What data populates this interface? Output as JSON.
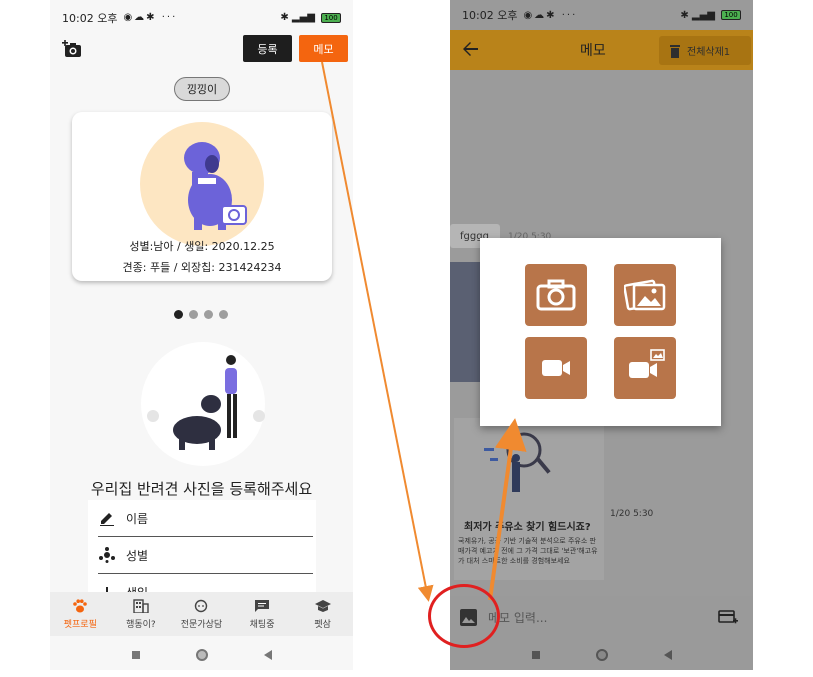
{
  "left_screen": {
    "status": {
      "time": "10:02 오후",
      "battery": "100"
    },
    "header": {
      "register_label": "등록",
      "memo_label": "메모"
    },
    "pet_name": "낑낑이",
    "profile": {
      "line1": "성별:남아 / 생일: 2020.12.25",
      "line2": "견종: 푸들 / 외장칩: 231424234"
    },
    "register_prompt": "우리집 반려견 사진을 등록해주세요",
    "form": {
      "name_label": "이름",
      "gender_label": "성별",
      "birth_label": "생일"
    },
    "nav": [
      {
        "label": "펫프로필"
      },
      {
        "label": "행동이?"
      },
      {
        "label": "전문가상담"
      },
      {
        "label": "채팅중"
      },
      {
        "label": "펫삼"
      }
    ],
    "accent_color": "#f4650f"
  },
  "right_screen": {
    "status": {
      "time": "10:02 오후",
      "battery": "100"
    },
    "appbar": {
      "title": "메모",
      "delete_all_label": "전체삭제1"
    },
    "memo_chip": "fgggg",
    "memo_date_top": "1/20 5:30",
    "ad": {
      "title": "최저가 주유소 찾기 힘드시죠?",
      "body": "국제유가, 공공 기반 기술적 분석으로 주유소 판매가격 예고가 전에 그 가격 그대로 '보관'해고유가 대처 스마트한 소비를 경험해보세요"
    },
    "memo_date_bottom": "1/20 5:30",
    "input": {
      "placeholder": "메모 입력..."
    },
    "picker_tiles": [
      "camera-icon",
      "gallery-icon",
      "video-icon",
      "video-gallery-icon"
    ],
    "appbar_color": "#b9831a",
    "tile_color": "#b8754a"
  },
  "annotations": {
    "arrow_color": "#f08a30",
    "circle_color": "#e02020"
  }
}
